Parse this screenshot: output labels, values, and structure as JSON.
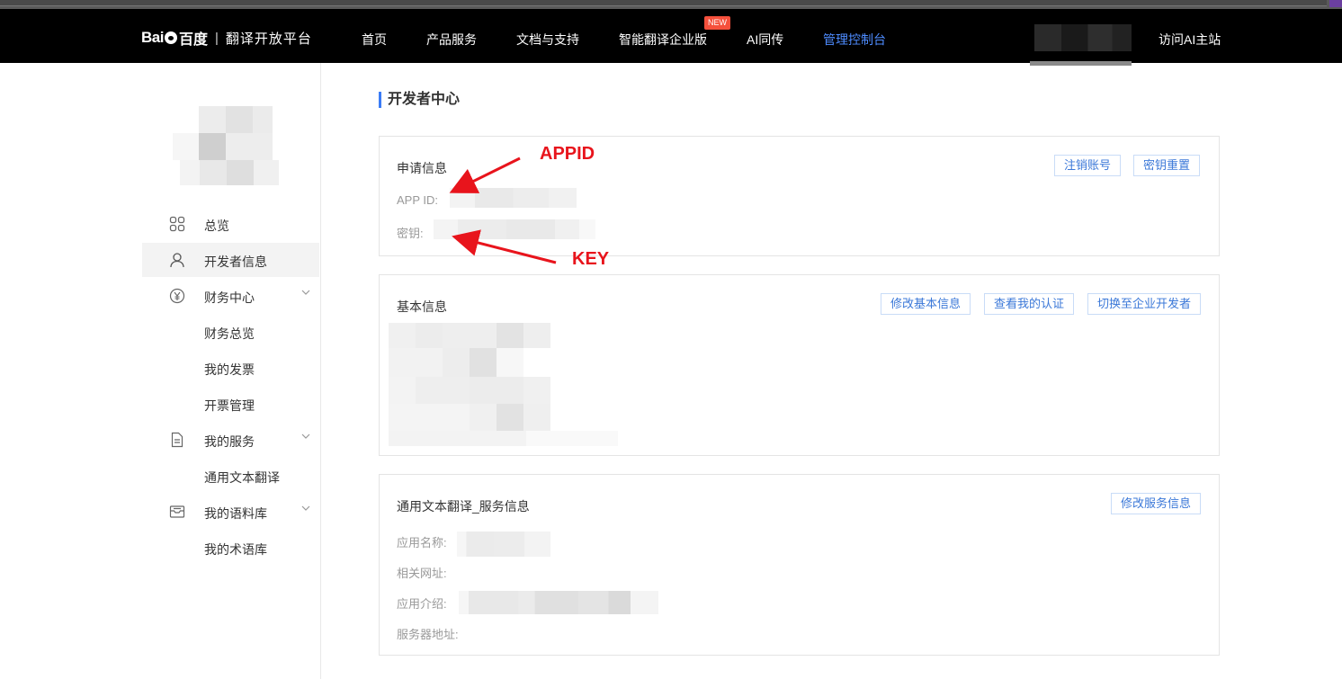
{
  "nav": {
    "logo_bai": "Bai",
    "logo_cn": "百度",
    "logo_sep": "|",
    "logo_sub": "翻译开放平台",
    "items": [
      {
        "label": "首页"
      },
      {
        "label": "产品服务"
      },
      {
        "label": "文档与支持"
      },
      {
        "label": "智能翻译企业版"
      },
      {
        "label": "AI同传"
      },
      {
        "label": "管理控制台"
      }
    ],
    "new_badge": "NEW",
    "visit": "访问AI主站",
    "active_color": "#4e8cff"
  },
  "sidebar": {
    "items": [
      {
        "label": "总览",
        "icon": "grid-icon"
      },
      {
        "label": "开发者信息",
        "icon": "user-icon"
      },
      {
        "label": "财务中心",
        "icon": "yen-icon"
      },
      {
        "label": "财务总览"
      },
      {
        "label": "我的发票"
      },
      {
        "label": "开票管理"
      },
      {
        "label": "我的服务",
        "icon": "document-icon"
      },
      {
        "label": "通用文本翻译"
      },
      {
        "label": "我的语料库",
        "icon": "inbox-icon"
      },
      {
        "label": "我的术语库"
      }
    ]
  },
  "page": {
    "title": "开发者中心"
  },
  "apply_card": {
    "title": "申请信息",
    "btn_cancel": "注销账号",
    "btn_reset": "密钥重置",
    "appid_label": "APP ID:",
    "key_label": "密钥:"
  },
  "basic_card": {
    "title": "基本信息",
    "btn_edit": "修改基本信息",
    "btn_auth": "查看我的认证",
    "btn_switch": "切换至企业开发者"
  },
  "service_card": {
    "title": "通用文本翻译_服务信息",
    "btn_edit": "修改服务信息",
    "app_name_label": "应用名称:",
    "url_label": "相关网址:",
    "intro_label": "应用介绍:",
    "server_label": "服务器地址:"
  },
  "annotations": {
    "appid": "APPID",
    "key": "KEY",
    "color": "#e8141c"
  }
}
